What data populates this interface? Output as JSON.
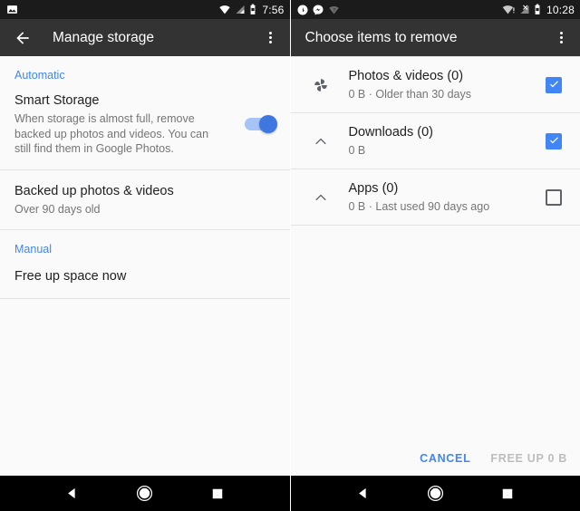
{
  "left_screen": {
    "statusbar": {
      "time": "7:56",
      "notification_icons": [
        "image-icon"
      ],
      "system_icons": [
        "wifi-icon",
        "cell-signal-icon",
        "battery-icon"
      ]
    },
    "appbar": {
      "back_icon": "arrow-back-icon",
      "title": "Manage storage",
      "overflow_icon": "more-vert-icon"
    },
    "sections": [
      {
        "label": "Automatic",
        "rows": [
          {
            "title": "Smart Storage",
            "subtitle": "When storage is almost full, remove backed up photos and videos. You can still find them in Google Photos.",
            "control": "toggle",
            "toggle_on": true
          },
          {
            "title": "Backed up photos & videos",
            "subtitle": "Over 90 days old",
            "control": "none"
          }
        ]
      },
      {
        "label": "Manual",
        "rows": [
          {
            "title": "Free up space now",
            "subtitle": "",
            "control": "none"
          }
        ]
      }
    ]
  },
  "right_screen": {
    "statusbar": {
      "time": "10:28",
      "notification_icons": [
        "clock-icon",
        "messenger-icon",
        "wifi-question-icon"
      ],
      "system_icons": [
        "wifi-alert-icon",
        "cell-signal-off-icon",
        "battery-icon"
      ]
    },
    "appbar": {
      "title": "Choose items to remove",
      "overflow_icon": "more-vert-icon"
    },
    "items": [
      {
        "icon": "google-photos-pinwheel-icon",
        "title": "Photos & videos (0)",
        "subtitle": "0 B · Older than 30 days",
        "checked": true
      },
      {
        "icon": "chevron-up-icon",
        "title": "Downloads (0)",
        "subtitle": "0 B",
        "checked": true
      },
      {
        "icon": "chevron-up-icon",
        "title": "Apps (0)",
        "subtitle": "0 B · Last used 90 days ago",
        "checked": false
      }
    ],
    "actions": {
      "cancel_label": "CANCEL",
      "free_up_label": "FREE UP 0 B"
    }
  },
  "navbar": {
    "back_icon": "nav-back-triangle-icon",
    "home_icon": "nav-home-circle-icon",
    "recents_icon": "nav-recents-square-icon"
  },
  "colors": {
    "accent_blue": "#4285f4",
    "appbar_bg": "#333333",
    "statusbar_bg": "#1b1b1b",
    "page_bg": "#fafafa",
    "primary_text": "#212121",
    "secondary_text": "#757575"
  }
}
